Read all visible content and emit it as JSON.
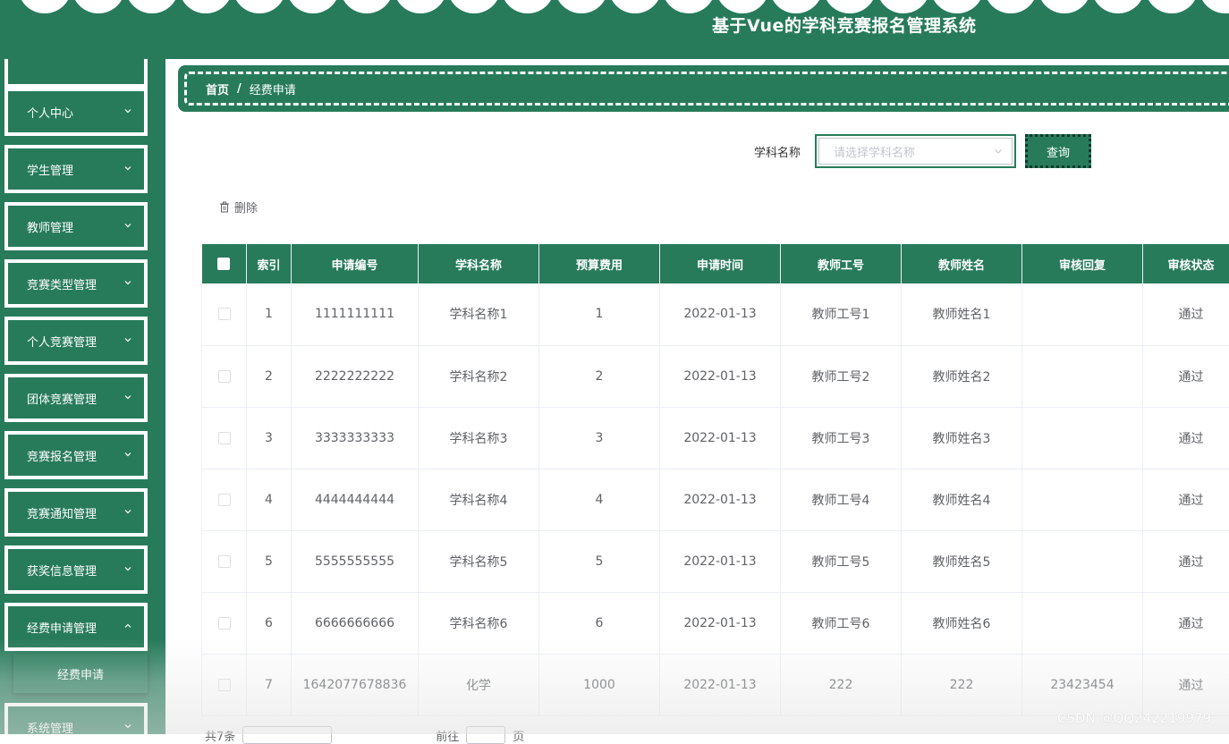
{
  "app": {
    "title": "基于Vue的学科竞赛报名管理系统"
  },
  "sidebar": {
    "items": [
      {
        "label": ""
      },
      {
        "label": "个人中心"
      },
      {
        "label": "学生管理"
      },
      {
        "label": "教师管理"
      },
      {
        "label": "竞赛类型管理"
      },
      {
        "label": "个人竞赛管理"
      },
      {
        "label": "团体竞赛管理"
      },
      {
        "label": "竞赛报名管理"
      },
      {
        "label": "竞赛通知管理"
      },
      {
        "label": "获奖信息管理"
      },
      {
        "label": "经费申请管理"
      },
      {
        "label": "系统管理"
      }
    ],
    "sub_item": {
      "label": "经费申请"
    },
    "icons": {
      "expand": "chevron-down-icon"
    }
  },
  "breadcrumb": {
    "home": "首页",
    "separator": "/",
    "current": "经费申请"
  },
  "search": {
    "label": "学科名称",
    "placeholder": "请选择学科名称",
    "button": "查询"
  },
  "toolbar": {
    "delete_label": "删除",
    "delete_icon": "trash-icon"
  },
  "table": {
    "headers": [
      "",
      "索引",
      "申请编号",
      "学科名称",
      "预算费用",
      "申请时间",
      "教师工号",
      "教师姓名",
      "审核回复",
      "审核状态"
    ],
    "rows": [
      [
        "1",
        "1111111111",
        "学科名称1",
        "1",
        "2022-01-13",
        "教师工号1",
        "教师姓名1",
        "",
        "通过"
      ],
      [
        "2",
        "2222222222",
        "学科名称2",
        "2",
        "2022-01-13",
        "教师工号2",
        "教师姓名2",
        "",
        "通过"
      ],
      [
        "3",
        "3333333333",
        "学科名称3",
        "3",
        "2022-01-13",
        "教师工号3",
        "教师姓名3",
        "",
        "通过"
      ],
      [
        "4",
        "4444444444",
        "学科名称4",
        "4",
        "2022-01-13",
        "教师工号4",
        "教师姓名4",
        "",
        "通过"
      ],
      [
        "5",
        "5555555555",
        "学科名称5",
        "5",
        "2022-01-13",
        "教师工号5",
        "教师姓名5",
        "",
        "通过"
      ],
      [
        "6",
        "6666666666",
        "学科名称6",
        "6",
        "2022-01-13",
        "教师工号6",
        "教师姓名6",
        "",
        "通过"
      ],
      [
        "7",
        "1642077678836",
        "化学",
        "1000",
        "2022-01-13",
        "222",
        "222",
        "23423454",
        "通过"
      ]
    ]
  },
  "pager": {
    "left": "共7条",
    "goto": "前往",
    "unit": "页"
  },
  "watermark": "CSDN @QQ242219979",
  "colors": {
    "primary": "#277b5b",
    "text": "#606266",
    "border": "#ebeef5"
  }
}
